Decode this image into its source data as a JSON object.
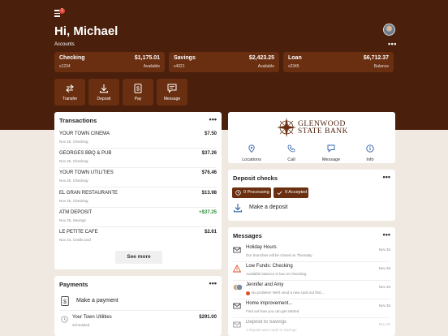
{
  "header": {
    "greeting": "Hi, Michael",
    "accounts_label": "Accounts",
    "menu_badge": "1",
    "more": "•••"
  },
  "accounts": [
    {
      "name": "Checking",
      "number": "x1234",
      "amount": "$1,175.01",
      "label": "Available"
    },
    {
      "name": "Savings",
      "number": "x4321",
      "amount": "$2,423.25",
      "label": "Available"
    },
    {
      "name": "Loan",
      "number": "x2345",
      "amount": "$6,712.37",
      "label": "Balance"
    }
  ],
  "quick_actions": [
    {
      "label": "Transfer",
      "icon": "transfer-icon"
    },
    {
      "label": "Deposit",
      "icon": "download-icon"
    },
    {
      "label": "Pay",
      "icon": "dollar-icon"
    },
    {
      "label": "Message",
      "icon": "message-icon"
    }
  ],
  "transactions": {
    "title": "Transactions",
    "more": "•••",
    "items": [
      {
        "name": "YOUR TOWN CINEMA",
        "detail": "Nov 25, Checking",
        "amount": "$7.50",
        "positive": false
      },
      {
        "name": "GEORGES BBQ & PUB",
        "detail": "Nov 25, Checking",
        "amount": "$37.26",
        "positive": false
      },
      {
        "name": "YOUR TOWN UTILITIES",
        "detail": "Nov 25, Checking",
        "amount": "$76.46",
        "positive": false
      },
      {
        "name": "EL GRAN RESTAURANTE",
        "detail": "Nov 25, Checking",
        "amount": "$13.98",
        "positive": false
      },
      {
        "name": "ATM DEPOSIT",
        "detail": "Nov 25, Savings",
        "amount": "+$37.25",
        "positive": true
      },
      {
        "name": "LE PETITE CAFE",
        "detail": "Nov 24, Credit card",
        "amount": "$2.61",
        "positive": false
      }
    ],
    "see_more": "See more"
  },
  "payments": {
    "title": "Payments",
    "more": "•••",
    "make_payment": "Make a payment",
    "items": [
      {
        "name": "Your Town Utilities",
        "status": "Scheduled",
        "amount": "$291.00"
      }
    ]
  },
  "bank": {
    "name_line1": "GLENWOOD",
    "name_line2": "STATE BANK",
    "links": [
      {
        "label": "Locations",
        "icon": "location-pin-icon"
      },
      {
        "label": "Call",
        "icon": "phone-icon"
      },
      {
        "label": "Message",
        "icon": "message-icon"
      },
      {
        "label": "Info",
        "icon": "info-icon"
      }
    ]
  },
  "deposit_checks": {
    "title": "Deposit checks",
    "more": "•••",
    "processing": "0 Processing",
    "accepted": "9 Accepted",
    "make_deposit": "Make a deposit"
  },
  "messages": {
    "title": "Messages",
    "more": "•••",
    "items": [
      {
        "title": "Holiday Hours",
        "snippet": "Our branches will be closed on Thursday.",
        "date": "Nov 25",
        "icon": "envelope-icon"
      },
      {
        "title": "Low Funds: Checking",
        "snippet": "Available balance is low on Checking.",
        "date": "Nov 25",
        "icon": "warning-icon"
      },
      {
        "title": "Jennifer and Amy",
        "snippet": "No problem! We'll send a new card out first...",
        "date": "Nov 25",
        "icon": "people-icon"
      },
      {
        "title": "Home improvement...",
        "snippet": "Find out how you can get started",
        "date": "Nov 25",
        "icon": "envelope-icon"
      },
      {
        "title": "Deposit to Savings",
        "snippet": "A deposit was made to Savings",
        "date": "Nov 25",
        "icon": "envelope-icon"
      }
    ]
  },
  "colors": {
    "brand_dark": "#4a1f0c",
    "brand": "#6a2e10",
    "background": "#efe9e2",
    "positive": "#2e8b3a",
    "warning": "#d9532b"
  }
}
